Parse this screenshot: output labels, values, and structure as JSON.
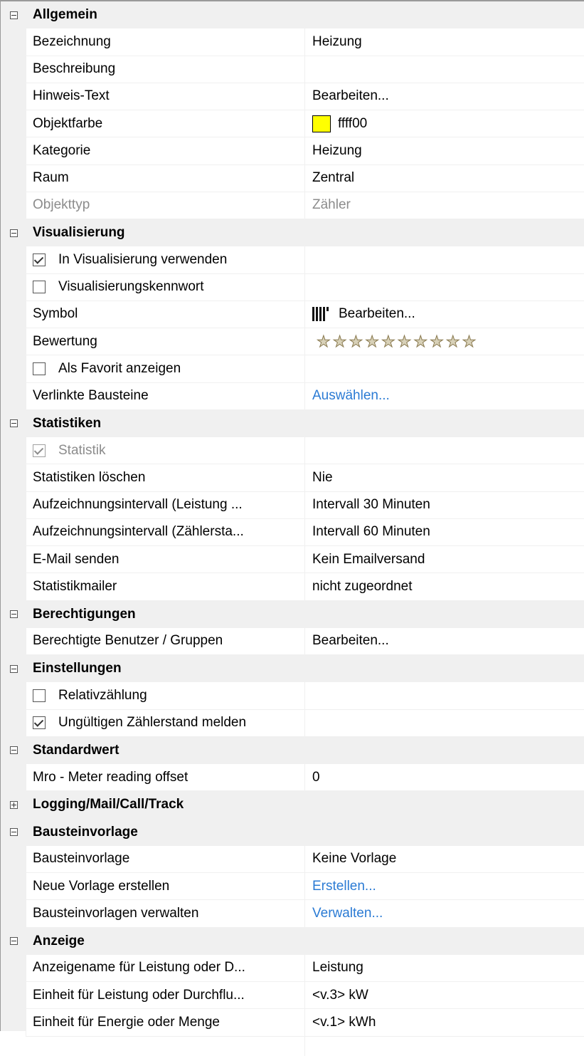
{
  "rows": [
    {
      "kind": "category",
      "label": "Allgemein",
      "expanded": true
    },
    {
      "kind": "prop",
      "name": "Bezeichnung",
      "value": "Heizung"
    },
    {
      "kind": "prop",
      "name": "Beschreibung",
      "value": ""
    },
    {
      "kind": "prop",
      "name": "Hinweis-Text",
      "value": "Bearbeiten..."
    },
    {
      "kind": "prop",
      "name": "Objektfarbe",
      "value": "ffff00",
      "swatch": "#ffff00"
    },
    {
      "kind": "prop",
      "name": "Kategorie",
      "value": "Heizung"
    },
    {
      "kind": "prop",
      "name": "Raum",
      "value": "Zentral"
    },
    {
      "kind": "prop",
      "name": "Objekttyp",
      "value": "Zähler",
      "disabled": true
    },
    {
      "kind": "category",
      "label": "Visualisierung",
      "expanded": true
    },
    {
      "kind": "check",
      "name": "In Visualisierung verwenden",
      "checked": true
    },
    {
      "kind": "check",
      "name": "Visualisierungskennwort",
      "checked": false
    },
    {
      "kind": "prop",
      "name": "Symbol",
      "value": "Bearbeiten...",
      "icon": "radiator-icon"
    },
    {
      "kind": "rating",
      "name": "Bewertung",
      "stars": 10,
      "filled": 0
    },
    {
      "kind": "check",
      "name": "Als Favorit anzeigen",
      "checked": false
    },
    {
      "kind": "prop",
      "name": "Verlinkte Bausteine",
      "value": "Auswählen...",
      "link": true
    },
    {
      "kind": "category",
      "label": "Statistiken",
      "expanded": true
    },
    {
      "kind": "check",
      "name": "Statistik",
      "checked": true,
      "disabled": true
    },
    {
      "kind": "prop",
      "name": "Statistiken löschen",
      "value": "Nie"
    },
    {
      "kind": "prop",
      "name": "Aufzeichnungsintervall (Leistung ...",
      "value": "Intervall 30 Minuten"
    },
    {
      "kind": "prop",
      "name": "Aufzeichnungsintervall (Zählersta...",
      "value": "Intervall 60 Minuten"
    },
    {
      "kind": "prop",
      "name": "E-Mail senden",
      "value": "Kein Emailversand"
    },
    {
      "kind": "prop",
      "name": "Statistikmailer",
      "value": "nicht zugeordnet"
    },
    {
      "kind": "category",
      "label": "Berechtigungen",
      "expanded": true
    },
    {
      "kind": "prop",
      "name": "Berechtigte Benutzer / Gruppen",
      "value": "Bearbeiten..."
    },
    {
      "kind": "category",
      "label": "Einstellungen",
      "expanded": true
    },
    {
      "kind": "check",
      "name": "Relativzählung",
      "checked": false
    },
    {
      "kind": "check",
      "name": "Ungültigen Zählerstand melden",
      "checked": true
    },
    {
      "kind": "category",
      "label": "Standardwert",
      "expanded": true
    },
    {
      "kind": "prop",
      "name": "Mro - Meter reading offset",
      "value": "0"
    },
    {
      "kind": "category",
      "label": "Logging/Mail/Call/Track",
      "expanded": false
    },
    {
      "kind": "category",
      "label": "Bausteinvorlage",
      "expanded": true
    },
    {
      "kind": "prop",
      "name": "Bausteinvorlage",
      "value": "Keine Vorlage"
    },
    {
      "kind": "prop",
      "name": "Neue Vorlage erstellen",
      "value": "Erstellen...",
      "link": true
    },
    {
      "kind": "prop",
      "name": "Bausteinvorlagen verwalten",
      "value": "Verwalten...",
      "link": true
    },
    {
      "kind": "category",
      "label": "Anzeige",
      "expanded": true
    },
    {
      "kind": "prop",
      "name": "Anzeigename für Leistung oder D...",
      "value": "Leistung"
    },
    {
      "kind": "prop",
      "name": "Einheit für Leistung oder Durchflu...",
      "value": "<v.3> kW"
    },
    {
      "kind": "prop",
      "name": "Einheit für Energie oder Menge",
      "value": "<v.1> kWh"
    }
  ]
}
